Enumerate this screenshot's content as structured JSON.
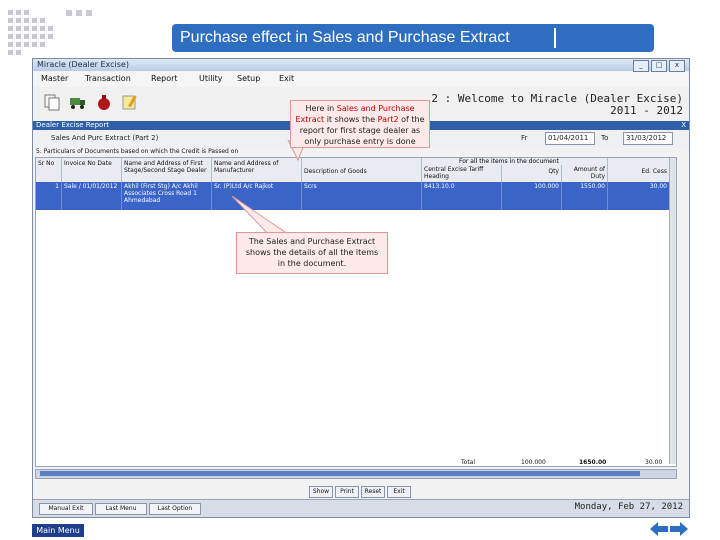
{
  "slide_title": "Purchase effect in Sales and Purchase Extract",
  "window": {
    "title": "Miracle (Dealer Excise)",
    "menu": [
      "Master",
      "Transaction",
      "Report",
      "Utility",
      "Setup",
      "Exit"
    ],
    "welcome_line1": "2 : Welcome to Miracle (Dealer Excise)",
    "welcome_line2": "2011 - 2012",
    "subwindow_title": "Dealer Excise Report",
    "close_glyph": "X",
    "form_label": "Sales And Purc Extract (Part 2)",
    "from_label": "Fr",
    "from_date": "01/04/2011",
    "to_label": "To",
    "to_date": "31/03/2012",
    "part_label": "5. Particulars of Documents based on which the Credit is Passed on"
  },
  "grid": {
    "group_header": "For all the items in the document",
    "columns": [
      "Sr No",
      "Invoice No Date",
      "Name and Address of First Stage/Second Stage Dealer",
      "Name and Address of Manufacturer",
      "Description of Goods",
      "Central Excise Tariff Heading",
      "Qty",
      "Amount of Duty",
      "Ed. Cess",
      "S"
    ],
    "row": {
      "sr": "1",
      "invoice": "Sale / 01/01/2012",
      "dealer": "Akhil (First Stg) A/c Akhil Associates Cross Road 1 Ahmedabad",
      "manufacturer": "Sr. (P)Ltd A/c Rajkot",
      "goods": "Scrs",
      "tariff": "8413.10.0",
      "qty": "100.000",
      "duty": "1550.00",
      "cess": "30.00"
    },
    "totals": {
      "label": "Total",
      "qty": "100.000",
      "duty": "1650.00",
      "cess": "30.00"
    }
  },
  "buttons": [
    "Show",
    "Print",
    "Reset",
    "Exit"
  ],
  "status_buttons": [
    "Manual Exit",
    "Last Menu",
    "Last Option"
  ],
  "status_date": "Monday, Feb 27, 2012",
  "callout1": {
    "before": "Here in ",
    "hl1": "Sales and Purchase Extract",
    "mid": " it shows the ",
    "hl2": "Part2",
    "after": " of the report for first stage dealer as only purchase entry is done"
  },
  "callout2": "The Sales and Purchase Extract shows the details of all the items in the document.",
  "main_menu": "Main Menu",
  "colors": {
    "banner": "#2e6ec0",
    "selection": "#3a64c8",
    "highlight": "#c00000"
  },
  "icons": [
    "slide-dots-icon",
    "document-copy-icon",
    "truck-icon",
    "money-bag-icon",
    "pencil-note-icon",
    "back-arrow-icon",
    "forward-arrow-icon"
  ]
}
